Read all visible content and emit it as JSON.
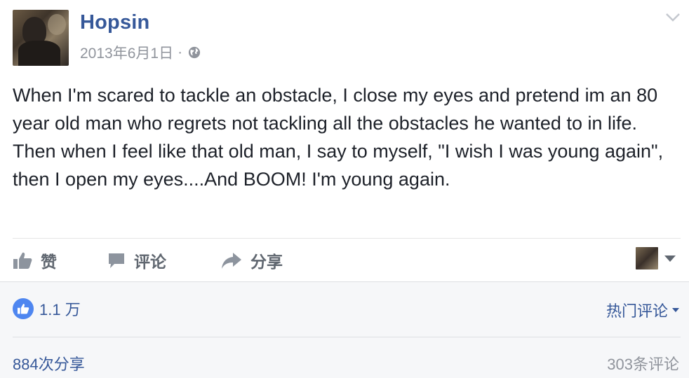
{
  "post": {
    "author": "Hopsin",
    "date": "2013年6月1日",
    "separator": "·",
    "privacy_icon": "globe-icon",
    "options_icon": "chevron-down-icon",
    "text": "When I'm scared to tackle an obstacle, I close my eyes and pretend im an 80 year old man who regrets not tackling all the obstacles he wanted to in life. Then when I feel like that old man, I say to myself, \"I wish I was young again\", then I open my eyes....And BOOM! I'm young again."
  },
  "actions": {
    "like_label": "赞",
    "comment_label": "评论",
    "share_label": "分享"
  },
  "stats": {
    "likes": "1.1 万",
    "sort_label": "热门评论",
    "shares": "884次分享",
    "comments": "303条评论"
  },
  "colors": {
    "link_blue": "#365899",
    "like_blue": "#4e86f0",
    "muted": "#90949c",
    "footer_bg": "#f6f7f9"
  }
}
